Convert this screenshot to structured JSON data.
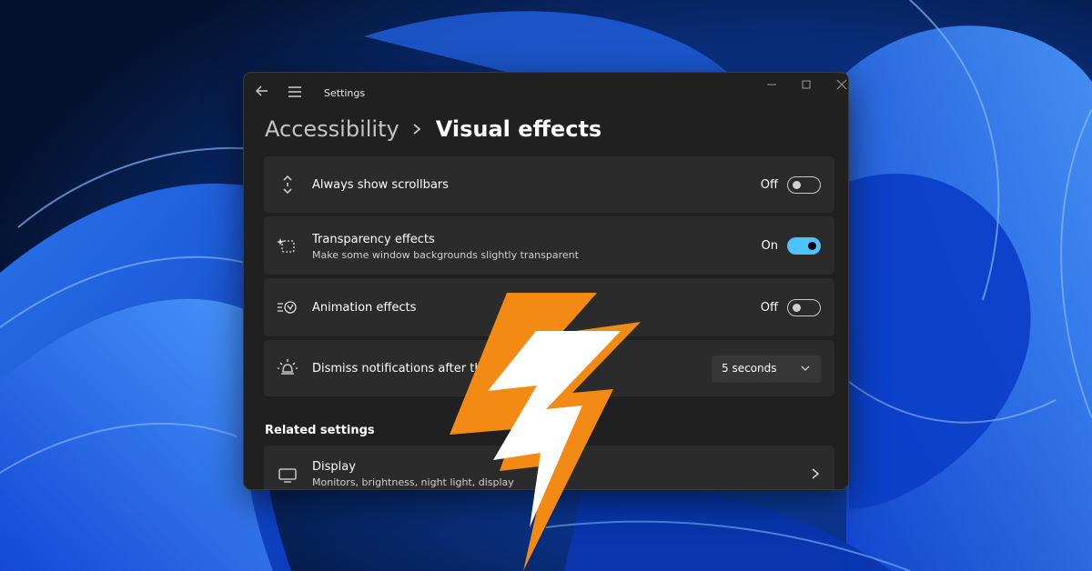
{
  "colors": {
    "accent": "#4cc2ff",
    "bolt_outer": "#f28a14",
    "bolt_inner": "#ffffff",
    "window_bg": "#202020",
    "card_bg": "#2b2b2b"
  },
  "window": {
    "title": "Settings",
    "controls": [
      "minimize-icon",
      "maximize-icon",
      "close-icon"
    ]
  },
  "breadcrumb": {
    "parent": "Accessibility",
    "current": "Visual effects"
  },
  "settings": [
    {
      "icon": "scrollbar-icon",
      "title": "Always show scrollbars",
      "state": "Off",
      "on": false
    },
    {
      "icon": "transparency-icon",
      "title": "Transparency effects",
      "subtitle": "Make some window backgrounds slightly transparent",
      "state": "On",
      "on": true
    },
    {
      "icon": "animation-icon",
      "title": "Animation effects",
      "state": "Off",
      "on": false
    },
    {
      "icon": "notification-timer-icon",
      "title": "Dismiss notifications after this a",
      "dropdown_value": "5 seconds"
    }
  ],
  "related": {
    "heading": "Related settings",
    "items": [
      {
        "icon": "display-icon",
        "title": "Display",
        "subtitle": "Monitors, brightness, night light, display"
      }
    ]
  },
  "overlay": {
    "icon": "lightning-bolt-icon"
  }
}
